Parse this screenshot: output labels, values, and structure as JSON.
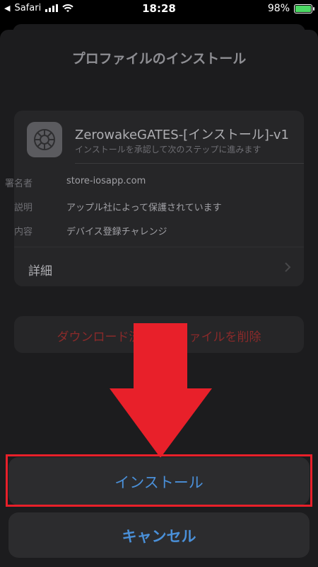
{
  "status_bar": {
    "carrier": "Safari",
    "time": "18:28",
    "battery_percent": "98%"
  },
  "sheet": {
    "title": "プロファイルのインストール"
  },
  "profile": {
    "name": "ZerowakeGATES-[インストール]-v1",
    "subtitle": "インストールを承認して次のステップに進みます",
    "signer_label": "署名者",
    "signer_value": "store-iosapp.com",
    "description_label": "説明",
    "description_value": "アップル社によって保護されています",
    "contents_label": "内容",
    "contents_value": "デバイス登録チャレンジ",
    "details_label": "詳細"
  },
  "remove_button": {
    "label": "ダウンロード済みプロファイルを削除"
  },
  "install_button": {
    "label": "インストール"
  },
  "cancel_button": {
    "label": "キャンセル"
  },
  "colors": {
    "accent_blue": "#4a90d9",
    "highlight_red": "#e8202a",
    "arrow_red": "#e8202a",
    "destructive": "#8a2a2a"
  }
}
